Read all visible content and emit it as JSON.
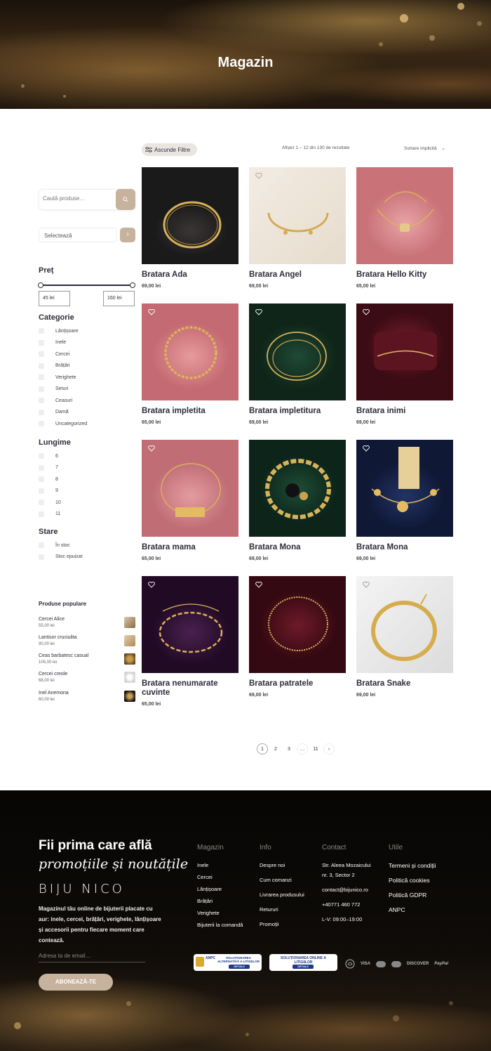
{
  "hero": {
    "title": "Magazin"
  },
  "toolbar": {
    "filter_label": "Ascunde Filtre",
    "results_text": "Afișez 1 – 12 din 130 de rezultate",
    "sort_label": "Sortare implicită"
  },
  "sidebar": {
    "search_placeholder": "Caută produse…",
    "select_label": "Selectează",
    "price": {
      "title": "Preț",
      "min": "45 lei",
      "max": "160 lei"
    },
    "categories": {
      "title": "Categorie",
      "items": [
        "Lănțișoare",
        "Inele",
        "Cercei",
        "Brățări",
        "Verighete",
        "Seturi",
        "Ceasuri",
        "Damă",
        "Uncategorized"
      ]
    },
    "length": {
      "title": "Lungime",
      "items": [
        "6",
        "7",
        "8",
        "9",
        "10",
        "11"
      ]
    },
    "stock": {
      "title": "Stare",
      "items": [
        "În stoc",
        "Stoc epuizat"
      ]
    },
    "popular": {
      "title": "Produse populare",
      "items": [
        {
          "name": "Cercei Alice",
          "price": "55,00 lei"
        },
        {
          "name": "Lantisor cruciulita",
          "price": "90,00 lei"
        },
        {
          "name": "Ceas barbatesc casual",
          "price": "105,00 lei"
        },
        {
          "name": "Cercei creole",
          "price": "68,00 lei"
        },
        {
          "name": "Inel Anemona",
          "price": "60,00 lei"
        }
      ]
    }
  },
  "products": [
    {
      "name": "Bratara Ada",
      "price": "69,00 lei"
    },
    {
      "name": "Bratara Angel",
      "price": "69,00 lei"
    },
    {
      "name": "Bratara Hello Kitty",
      "price": "65,00 lei"
    },
    {
      "name": "Bratara impletita",
      "price": "65,00 lei"
    },
    {
      "name": "Bratara impletitura",
      "price": "69,00 lei"
    },
    {
      "name": "Bratara inimi",
      "price": "69,00 lei"
    },
    {
      "name": "Bratara mama",
      "price": "65,00 lei"
    },
    {
      "name": "Bratara Mona",
      "price": "69,00 lei"
    },
    {
      "name": "Bratara Mona",
      "price": "69,00 lei"
    },
    {
      "name": "Bratara nenumarate cuvinte",
      "price": "65,00 lei"
    },
    {
      "name": "Bratara patratele",
      "price": "69,00 lei"
    },
    {
      "name": "Bratara Snake",
      "price": "69,00 lei"
    }
  ],
  "pagination": {
    "pages": [
      "1",
      "2",
      "3",
      "…",
      "11"
    ],
    "next": "›"
  },
  "footer": {
    "newsletter": {
      "title_line1": "Fii prima care află",
      "title_line2": "promoțiile și noutățile",
      "brand": "BIJU NICO",
      "text": "Magazinul tău online de bijuterii placate cu aur: inele, cercei, brățări, verighete, lănțișoare și accesorii pentru fiecare moment care contează.",
      "email_placeholder": "Adresa ta de email…",
      "button": "ABONEAZĂ-TE"
    },
    "magazin": {
      "title": "Magazin",
      "links": [
        "Inele",
        "Cercei",
        "Lănțișoare",
        "Brățări",
        "Verighete",
        "Bijuterii la comandă"
      ]
    },
    "info": {
      "title": "Info",
      "links": [
        "Despre noi",
        "Cum comanzi",
        "Livrarea produsului",
        "Retururi",
        "Promoții"
      ]
    },
    "contact": {
      "title": "Contact",
      "lines": [
        "Str. Aleea Mozaicului",
        "nr. 3, Sector 2",
        "",
        "contact@bijunico.ro",
        "",
        "+40771 460 772",
        "",
        "L-V: 09:00–19:00"
      ]
    },
    "utile": {
      "title": "Utile",
      "links": [
        "Termeni și condiții",
        "Politică cookies",
        "Politică GDPR",
        "ANPC"
      ]
    },
    "badges": {
      "anpc1_brand": "ANPC",
      "anpc1_text": "SOLUȚIONAREA ALTERNATIVĂ A LITIGIILOR",
      "anpc2_text": "SOLUȚIONAREA ONLINE A LITIGIILOR",
      "details": "DETALII"
    },
    "payments": [
      "VISA",
      "DISCOVER",
      "PayPal"
    ]
  },
  "colors": {
    "accent": "#c7b29d",
    "text": "#2c2c3a",
    "footer_bg": "#0a0806"
  }
}
